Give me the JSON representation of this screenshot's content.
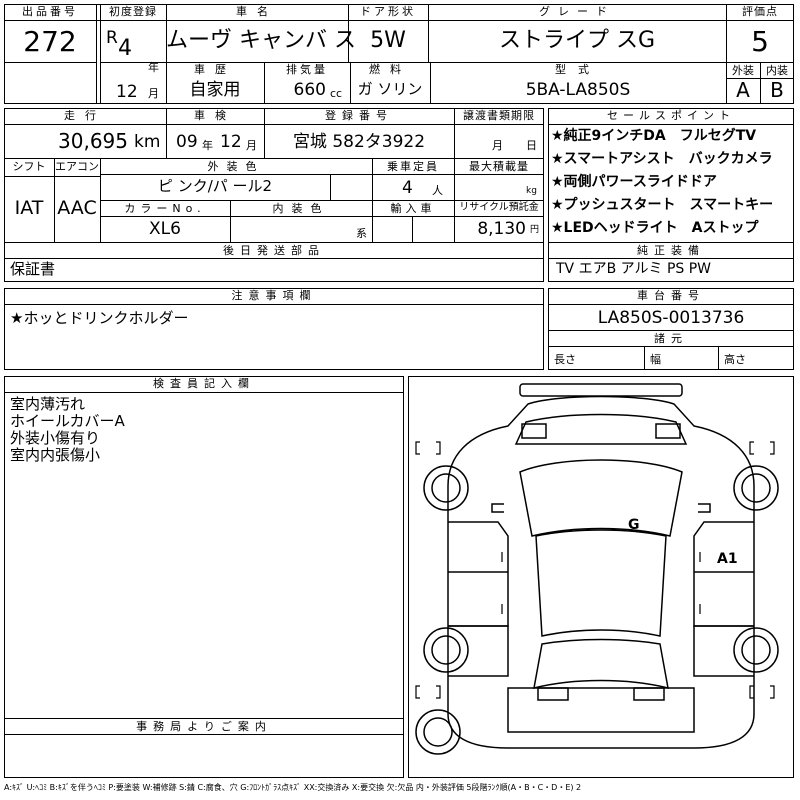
{
  "header": {
    "lot_label": "出品番号",
    "lot_value": "272",
    "first_reg_label": "初度登録",
    "era_prefix": "R",
    "year_value": "4",
    "year_unit": "年",
    "month_value": "12",
    "month_unit": "月",
    "car_name_label": "車名",
    "car_name_value": "ムーヴ キャンバ ス",
    "door_label": "ドア形状",
    "door_value": "5W",
    "grade_label": "グレード",
    "grade_value": "ストライプ スG",
    "score_label": "評価点",
    "score_value": "5",
    "history_label": "車歴",
    "history_value": "自家用",
    "displacement_label": "排気量",
    "displacement_value": "660",
    "displacement_unit": "cc",
    "fuel_label": "燃料",
    "fuel_value": "ガ ソリン",
    "model_label": "型式",
    "model_value": "5BA-LA850S",
    "exterior_label": "外装",
    "exterior_value": "A",
    "interior_label": "内装",
    "interior_value": "B"
  },
  "specs": {
    "mileage_label": "走行",
    "mileage_value": "30,695",
    "mileage_unit": "km",
    "inspection_label": "車検",
    "inspection_year": "09",
    "inspection_year_unit": "年",
    "inspection_month": "12",
    "inspection_month_unit": "月",
    "plate_label": "登録番号",
    "plate_value": "宮城 582タ3922",
    "transfer_label": "譲渡書類期限",
    "transfer_month_unit": "月",
    "transfer_day_unit": "日",
    "shift_label": "シフト",
    "shift_value": "IAT",
    "ac_label": "エアコン",
    "ac_value": "AAC",
    "color_label": "外装色",
    "color_value": "ピ ンク/パ ール2",
    "capacity_label": "乗車定員",
    "capacity_value": "4",
    "capacity_unit": "人",
    "load_label": "最大積載量",
    "load_unit": "kg",
    "color_no_label": "カラーNo.",
    "color_no_value": "XL6",
    "int_color_label": "内装色",
    "int_color_unit": "系",
    "import_label": "輸入車",
    "recycle_label": "リサイクル預託金",
    "recycle_value": "8,130",
    "recycle_unit": "円"
  },
  "sales_points": {
    "label": "セールスポイント",
    "items": [
      "★純正9インチDA　フルセグTV",
      "★スマートアシスト　バックカメラ",
      "★両側パワースライドドア",
      "★プッシュスタート　スマートキー",
      "★LEDヘッドライト　Aストップ"
    ]
  },
  "later_parts": {
    "label": "後日発送部品",
    "value": "保証書"
  },
  "equipment": {
    "label": "純正装備",
    "value": "TV エアB アルミ PS PW"
  },
  "notes": {
    "label": "注意事項欄",
    "value": "★ホッとドリンクホルダー"
  },
  "chassis": {
    "label": "車台番号",
    "value": "LA850S-0013736",
    "dims_label": "諸元",
    "length_label": "長さ",
    "width_label": "幅",
    "height_label": "高さ"
  },
  "inspector": {
    "label": "検査員記入欄",
    "lines": [
      "室内薄汚れ",
      "ホイールカバーA",
      "外装小傷有り",
      "室内内張傷小"
    ]
  },
  "office": {
    "label": "事務局よりご案内"
  },
  "diagram": {
    "marks": [
      {
        "code": "G",
        "where": "windshield"
      },
      {
        "code": "A1",
        "where": "right-rear-door"
      }
    ]
  },
  "legend": "A:ｷｽﾞ U:ﾍｺﾐ B:ｷｽﾞを伴うﾍｺﾐ P:要塗装 W:補修跡 S:錆 C:腐食、穴 G:ﾌﾛﾝﾄｶﾞﾗｽ点ｷｽﾞ XX:交換済み X:要交換 欠:欠品 内・外装評価 5段階ﾗﾝｸ順(A・B・C・D・E) 2"
}
